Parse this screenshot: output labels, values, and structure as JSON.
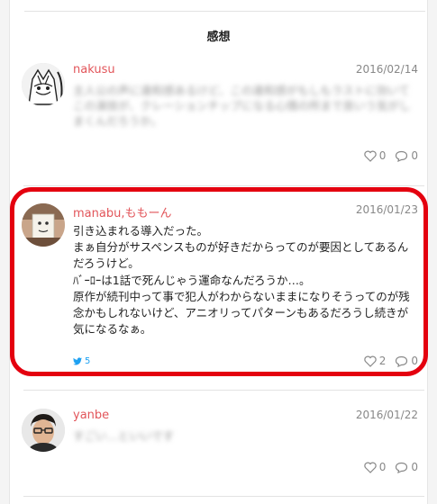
{
  "section": {
    "title": "感想"
  },
  "comments": [
    {
      "author": "nakusu",
      "date": "2016/02/14",
      "body": "主人公の声に違和感あるけど、この違和感がもしもラストに効いてこの演技が、クレーションチップになる心情の所まで良いう気がしまくんだろうか。",
      "likes": "0",
      "replies": "0"
    },
    {
      "author": "manabu,ももーん",
      "date": "2016/01/23",
      "body": "引き込まれる導入だった。\nまぁ自分がサスペンスものが好きだからってのが要因としてあるんだろうけど。\nﾊﾞｰﾛｰは1話で死んじゃう運命なんだろうか…。\n原作が続刊中って事で犯人がわからないままになりそうってのが残念かもしれないけど、アニオリってパターンもあるだろうし続きが気になるなぁ。",
      "tweets": "5",
      "likes": "2",
      "replies": "0"
    },
    {
      "author": "yanbe",
      "date": "2016/01/22",
      "body": "すごい…といいです",
      "likes": "0",
      "replies": "0"
    }
  ],
  "icons": {
    "like": "heart-icon",
    "reply": "speech-bubble-icon",
    "tweet": "twitter-bird-icon"
  },
  "colors": {
    "author": "#e2555a",
    "highlight": "#e4000f",
    "tweet": "#1da1f2"
  }
}
